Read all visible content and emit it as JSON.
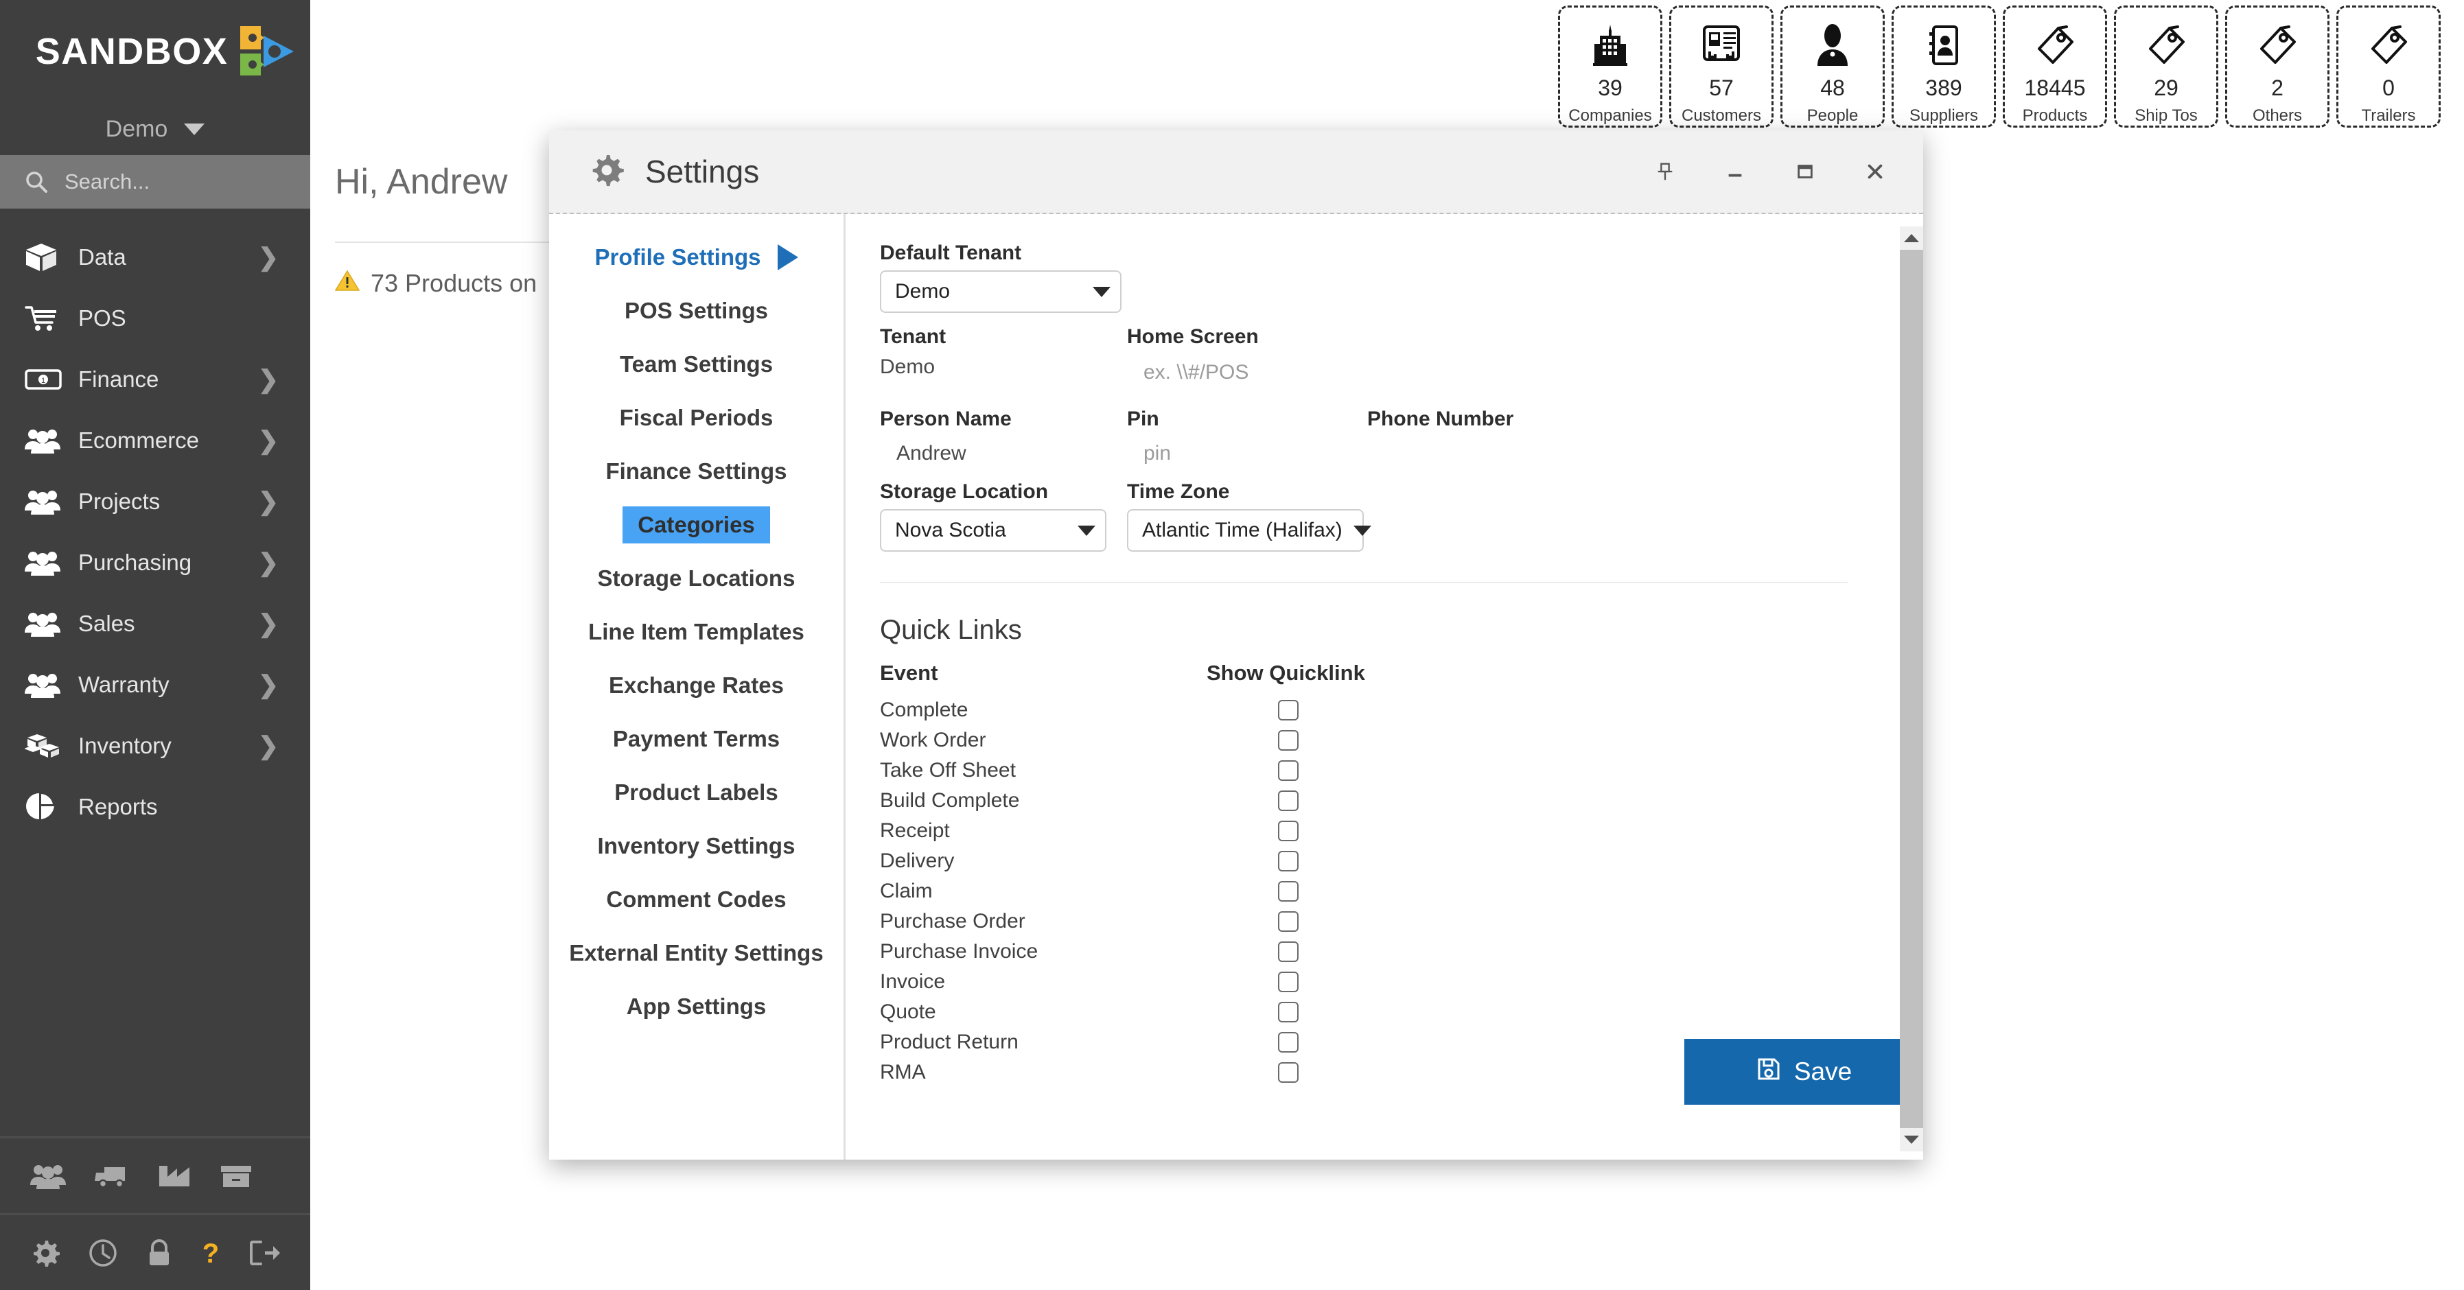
{
  "sidebar": {
    "brand": "SANDBOX",
    "brand_logo_icon": "sandbox-gears-play-logo",
    "tenant_selector": {
      "label": "Demo",
      "icon": "chevron-down-icon"
    },
    "search": {
      "placeholder": "Search...",
      "icon": "search-icon"
    },
    "items": [
      {
        "label": "Data",
        "icon": "box-icon",
        "has_arrow": true,
        "arrow": "❯"
      },
      {
        "label": "POS",
        "icon": "shopping-cart-icon",
        "has_arrow": false,
        "arrow": ""
      },
      {
        "label": "Finance",
        "icon": "money-bill-icon",
        "has_arrow": true,
        "arrow": "❯"
      },
      {
        "label": "Ecommerce",
        "icon": "users-group-icon",
        "has_arrow": true,
        "arrow": "❯"
      },
      {
        "label": "Projects",
        "icon": "users-group-icon",
        "has_arrow": true,
        "arrow": "❯"
      },
      {
        "label": "Purchasing",
        "icon": "users-group-icon",
        "has_arrow": true,
        "arrow": "❯"
      },
      {
        "label": "Sales",
        "icon": "users-group-icon",
        "has_arrow": true,
        "arrow": "❯"
      },
      {
        "label": "Warranty",
        "icon": "users-group-icon",
        "has_arrow": true,
        "arrow": "❯"
      },
      {
        "label": "Inventory",
        "icon": "boxes-stacked-icon",
        "has_arrow": true,
        "arrow": "❯"
      },
      {
        "label": "Reports",
        "icon": "pie-chart-icon",
        "has_arrow": false,
        "arrow": ""
      }
    ],
    "utility_icons_top": [
      "users-group-icon",
      "truck-icon",
      "factory-chart-icon",
      "archive-box-icon"
    ],
    "utility_icons_bottom": [
      "gear-icon",
      "clock-icon",
      "lock-icon",
      "question-mark-icon",
      "logout-icon"
    ],
    "colors": {
      "background": "#3f3f3f",
      "search_background": "#787878",
      "help_accent": "#f4b223"
    }
  },
  "main": {
    "greeting": "Hi, Andrew",
    "alert": {
      "icon": "warning-triangle-icon",
      "text": "73 Products on"
    },
    "stats": [
      {
        "value": "39",
        "label": "Companies",
        "icon": "building-icon"
      },
      {
        "value": "57",
        "label": "Customers",
        "icon": "id-card-icon"
      },
      {
        "value": "48",
        "label": "People",
        "icon": "person-silhouette-icon"
      },
      {
        "value": "389",
        "label": "Suppliers",
        "icon": "contact-book-icon"
      },
      {
        "value": "18445",
        "label": "Products",
        "icon": "tag-icon"
      },
      {
        "value": "29",
        "label": "Ship Tos",
        "icon": "tag-icon"
      },
      {
        "value": "2",
        "label": "Others",
        "icon": "tag-icon"
      },
      {
        "value": "0",
        "label": "Trailers",
        "icon": "tag-icon"
      }
    ]
  },
  "dialog": {
    "title": "Settings",
    "title_icon": "gear-icon",
    "controls": [
      {
        "name": "pin",
        "icon": "pin-icon"
      },
      {
        "name": "minimize",
        "icon": "minimize-icon"
      },
      {
        "name": "maximize",
        "icon": "maximize-icon"
      },
      {
        "name": "close",
        "icon": "close-icon"
      }
    ],
    "menu": [
      {
        "label": "Profile Settings",
        "state": "active"
      },
      {
        "label": "POS Settings",
        "state": "normal"
      },
      {
        "label": "Team Settings",
        "state": "normal"
      },
      {
        "label": "Fiscal Periods",
        "state": "normal"
      },
      {
        "label": "Finance Settings",
        "state": "normal"
      },
      {
        "label": "Categories",
        "state": "selected"
      },
      {
        "label": "Storage Locations",
        "state": "normal"
      },
      {
        "label": "Line Item Templates",
        "state": "normal"
      },
      {
        "label": "Exchange Rates",
        "state": "normal"
      },
      {
        "label": "Payment Terms",
        "state": "normal"
      },
      {
        "label": "Product Labels",
        "state": "normal"
      },
      {
        "label": "Inventory Settings",
        "state": "normal"
      },
      {
        "label": "Comment Codes",
        "state": "normal"
      },
      {
        "label": "External Entity Settings",
        "state": "normal"
      },
      {
        "label": "App Settings",
        "state": "normal"
      }
    ],
    "form": {
      "default_tenant": {
        "label": "Default Tenant",
        "value": "Demo"
      },
      "tenant": {
        "label": "Tenant",
        "value": "Demo"
      },
      "home_screen": {
        "label": "Home Screen",
        "value": "",
        "placeholder": "ex. \\\\#/POS"
      },
      "person_name": {
        "label": "Person Name",
        "value": "Andrew"
      },
      "pin": {
        "label": "Pin",
        "value": "",
        "placeholder": "pin"
      },
      "phone_number": {
        "label": "Phone Number",
        "value": ""
      },
      "storage_location": {
        "label": "Storage Location",
        "value": "Nova Scotia"
      },
      "time_zone": {
        "label": "Time Zone",
        "value": "Atlantic Time (Halifax)"
      }
    },
    "quick_links": {
      "title": "Quick Links",
      "col_event": "Event",
      "col_show": "Show Quicklink",
      "rows": [
        {
          "event": "Complete",
          "checked": false
        },
        {
          "event": "Work Order",
          "checked": false
        },
        {
          "event": "Take Off Sheet",
          "checked": false
        },
        {
          "event": "Build Complete",
          "checked": false
        },
        {
          "event": "Receipt",
          "checked": false
        },
        {
          "event": "Delivery",
          "checked": false
        },
        {
          "event": "Claim",
          "checked": false
        },
        {
          "event": "Purchase Order",
          "checked": false
        },
        {
          "event": "Purchase Invoice",
          "checked": false
        },
        {
          "event": "Invoice",
          "checked": false
        },
        {
          "event": "Quote",
          "checked": false
        },
        {
          "event": "Product Return",
          "checked": false
        },
        {
          "event": "RMA",
          "checked": false
        }
      ]
    },
    "save": {
      "label": "Save",
      "icon": "floppy-disk-icon",
      "color": "#1668ad"
    },
    "scrollbar": {
      "up_icon": "caret-up-icon",
      "down_icon": "caret-down-icon"
    }
  }
}
